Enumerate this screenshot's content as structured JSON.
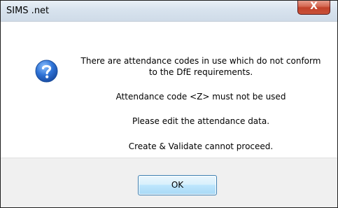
{
  "window": {
    "title": "SIMS .net",
    "close_glyph": "X"
  },
  "icon": {
    "name": "question-icon",
    "color": "#2a6bd0"
  },
  "message": {
    "line1": "There are attendance codes in use which do not conform",
    "line2": "to the DfE requirements.",
    "line3": "Attendance code <Z> must not be used",
    "line4": "Please edit the attendance data.",
    "line5": "Create & Validate cannot proceed."
  },
  "buttons": {
    "ok_label": "OK"
  }
}
